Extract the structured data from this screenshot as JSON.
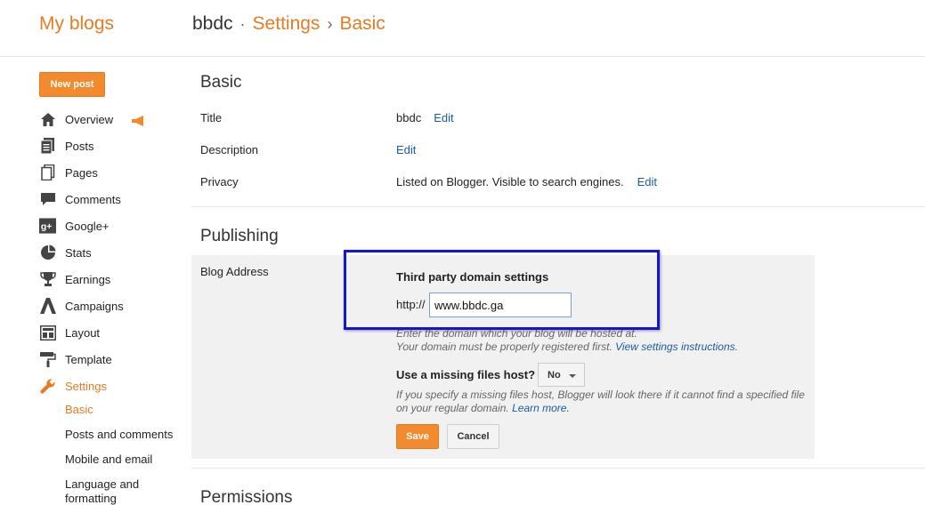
{
  "header": {
    "brand": "My blogs",
    "blog_name": "bbdc",
    "sep1": "·",
    "crumb_settings": "Settings",
    "sep2": "›",
    "crumb_basic": "Basic"
  },
  "sidebar": {
    "new_post": "New post",
    "items": [
      {
        "label": "Overview",
        "icon": "home-icon"
      },
      {
        "label": "Posts",
        "icon": "posts-icon"
      },
      {
        "label": "Pages",
        "icon": "pages-icon"
      },
      {
        "label": "Comments",
        "icon": "comment-icon"
      },
      {
        "label": "Google+",
        "icon": "google-plus-icon"
      },
      {
        "label": "Stats",
        "icon": "pie-chart-icon"
      },
      {
        "label": "Earnings",
        "icon": "trophy-icon"
      },
      {
        "label": "Campaigns",
        "icon": "campaigns-icon"
      },
      {
        "label": "Layout",
        "icon": "layout-icon"
      },
      {
        "label": "Template",
        "icon": "paint-roller-icon"
      },
      {
        "label": "Settings",
        "icon": "wrench-icon"
      }
    ],
    "settings_sub": [
      "Basic",
      "Posts and comments",
      "Mobile and email",
      "Language and formatting"
    ],
    "accent_color": "#e67b23"
  },
  "main": {
    "basic_heading": "Basic",
    "title_label": "Title",
    "title_value": "bbdc",
    "description_label": "Description",
    "privacy_label": "Privacy",
    "privacy_value": "Listed on Blogger. Visible to search engines.",
    "edit": "Edit",
    "publishing_heading": "Publishing",
    "blog_address_label": "Blog Address",
    "third_party_heading": "Third party domain settings",
    "http_prefix": "http://",
    "domain_value": "www.bbdc.ga",
    "help1": "Enter the domain which your blog will be hosted at.",
    "help2": "Your domain must be properly registered first.",
    "help2_link": "View settings instructions.",
    "missing_files_label": "Use a missing files host?",
    "missing_files_value": "No",
    "help3": "If you specify a missing files host, Blogger will look there if it cannot find a specified file on your regular domain.",
    "help3_link": "Learn more.",
    "save": "Save",
    "cancel": "Cancel",
    "permissions_heading": "Permissions"
  }
}
